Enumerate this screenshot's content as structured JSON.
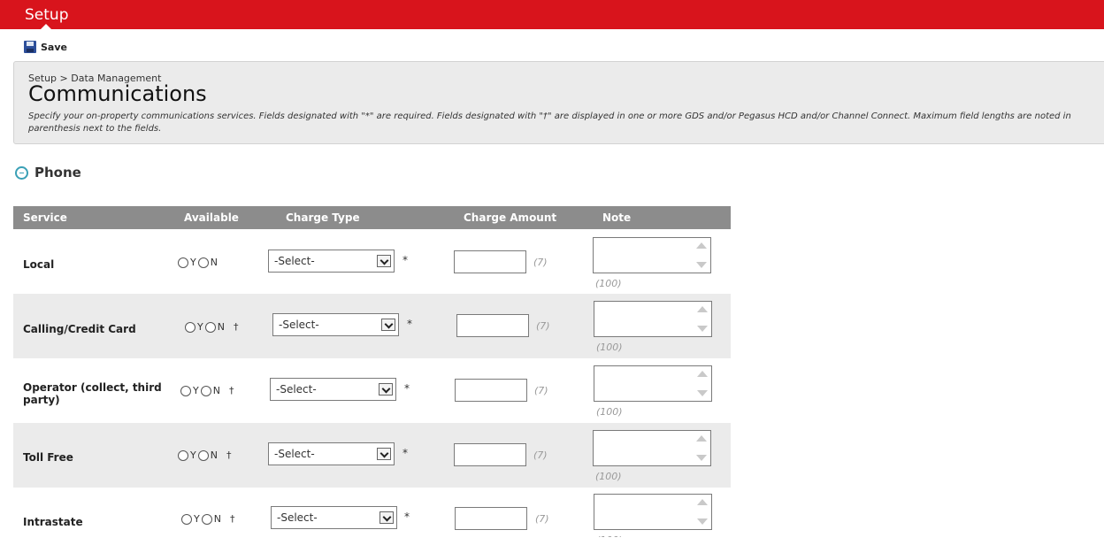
{
  "app": {
    "title": "Setup"
  },
  "toolbar": {
    "save_label": "Save"
  },
  "header": {
    "breadcrumb": "Setup > Data Management",
    "title": "Communications",
    "description": "Specify your on-property communications services. Fields designated with \"*\" are required. Fields designated with \"†\" are displayed in one or more GDS and/or Pegasus HCD and/or Channel Connect. Maximum field lengths are noted in parenthesis next to the fields."
  },
  "section": {
    "label": "Phone"
  },
  "table": {
    "columns": [
      "Service",
      "Available",
      "Charge Type",
      "Charge Amount",
      "Note"
    ],
    "yes_label": "Y",
    "no_label": "N",
    "dagger": "†",
    "required_mark": "*",
    "select_placeholder": "-Select-",
    "amount_hint": "(7)",
    "note_hint": "(100)",
    "rows": [
      {
        "service": "Local",
        "available": null,
        "gds": false,
        "charge_type": "-Select-",
        "amount": "",
        "note": ""
      },
      {
        "service": "Calling/Credit Card",
        "available": null,
        "gds": true,
        "charge_type": "-Select-",
        "amount": "",
        "note": ""
      },
      {
        "service": "Operator (collect, third party)",
        "available": null,
        "gds": true,
        "charge_type": "-Select-",
        "amount": "",
        "note": ""
      },
      {
        "service": "Toll Free",
        "available": null,
        "gds": true,
        "charge_type": "-Select-",
        "amount": "",
        "note": ""
      },
      {
        "service": "Intrastate",
        "available": null,
        "gds": true,
        "charge_type": "-Select-",
        "amount": "",
        "note": ""
      }
    ]
  },
  "colors": {
    "brand_red": "#d8141c",
    "header_gray": "#8c8c8c",
    "row_shade": "#ebebeb",
    "accent_teal": "#3aa0b6"
  }
}
